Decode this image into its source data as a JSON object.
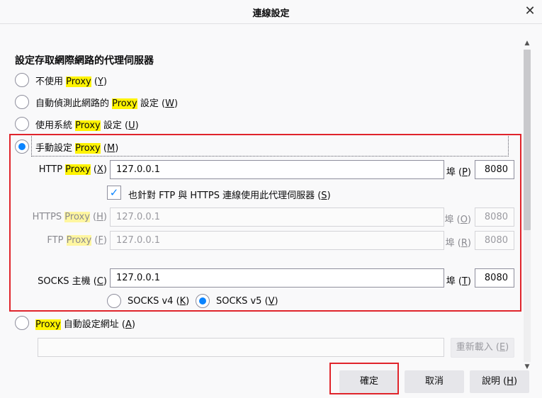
{
  "window": {
    "title": "連線設定",
    "close_icon": "close-icon"
  },
  "heading": "設定存取網際網路的代理伺服器",
  "options": {
    "no_proxy": {
      "pre": "不使用 ",
      "proxy": "Proxy",
      "sp": " (",
      "key": "Y",
      "post": ")"
    },
    "auto_detect": {
      "pre": "自動偵測此網路的 ",
      "proxy": "Proxy",
      "mid": " 設定 (",
      "key": "W",
      "post": ")"
    },
    "system": {
      "pre": "使用系統 ",
      "proxy": "Proxy",
      "mid": " 設定 (",
      "key": "U",
      "post": ")"
    },
    "manual": {
      "pre": "手動設定 ",
      "proxy": "Proxy",
      "sp": " (",
      "key": "M",
      "post": ")"
    },
    "autoconfig": {
      "proxy": "Proxy",
      "mid": " 自動設定網址 (",
      "key": "A",
      "post": ")"
    }
  },
  "http": {
    "pre": "HTTP ",
    "proxy": "Proxy",
    "sp": " (",
    "key": "X",
    "post": ")",
    "value": "127.0.0.1",
    "port_pre": "埠 (",
    "port_key": "P",
    "port_post": ")",
    "port": "8080"
  },
  "also_use": {
    "pre": "也針對 FTP 與 HTTPS 連線使用此代理伺服器 (",
    "key": "S",
    "post": ")",
    "checked": true
  },
  "https": {
    "pre": "HTTPS ",
    "proxy": "Proxy",
    "sp": " (",
    "key": "H",
    "post": ")",
    "value": "127.0.0.1",
    "port_pre": "埠 (",
    "port_key": "O",
    "port_post": ")",
    "port": "8080"
  },
  "ftp": {
    "pre": "FTP ",
    "proxy": "Proxy",
    "sp": " (",
    "key": "F",
    "post": ")",
    "value": "127.0.0.1",
    "port_pre": "埠 (",
    "port_key": "R",
    "port_post": ")",
    "port": "8080"
  },
  "socks": {
    "pre": "SOCKS 主機 (",
    "key": "C",
    "post": ")",
    "value": "127.0.0.1",
    "port_pre": "埠 (",
    "port_key": "T",
    "port_post": ")",
    "port": "8080",
    "v4": {
      "pre": "SOCKS v4 (",
      "key": "K",
      "post": ")"
    },
    "v5": {
      "pre": "SOCKS v5 (",
      "key": "V",
      "post": ")"
    }
  },
  "autoconfig_url": {
    "value": "",
    "reload": {
      "pre": "重新載入 (",
      "key": "E",
      "post": ")"
    }
  },
  "buttons": {
    "ok": "確定",
    "cancel": "取消",
    "help": {
      "pre": "說明 (",
      "key": "H",
      "post": ")"
    }
  },
  "colors": {
    "accent": "#0a84ff",
    "highlight": "#fff300",
    "annotation": "#e0242b"
  }
}
